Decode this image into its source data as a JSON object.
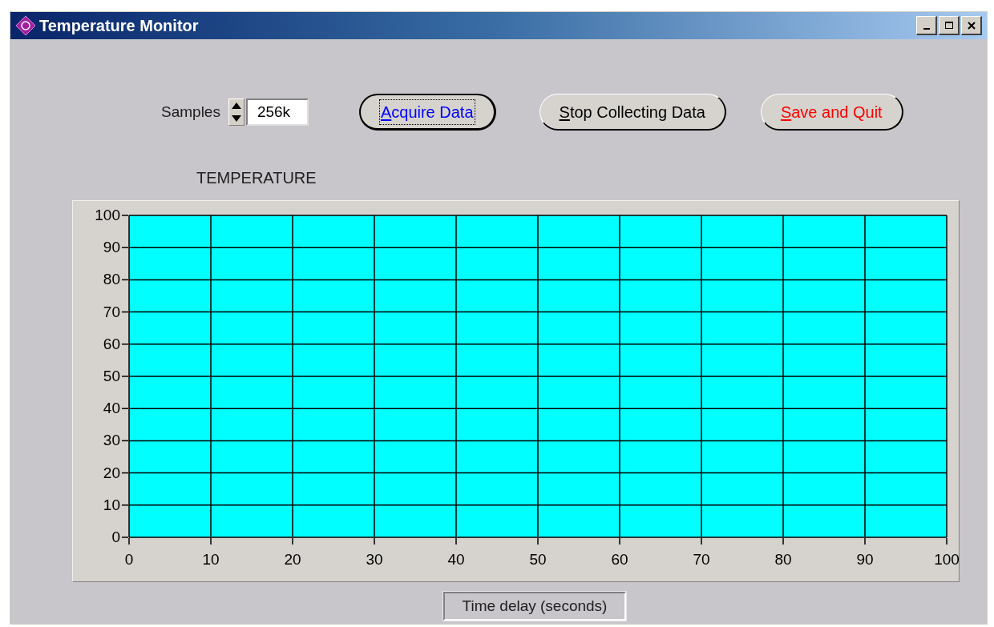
{
  "window": {
    "title": "Temperature Monitor",
    "controls": [
      {
        "kind": "minimize"
      },
      {
        "kind": "maximize"
      },
      {
        "kind": "close"
      }
    ]
  },
  "samples": {
    "label": "Samples",
    "value": "256k"
  },
  "buttons": [
    {
      "label": "Acquire Data",
      "color": "#0000ff",
      "focused": true
    },
    {
      "label": "Stop Collecting Data",
      "color": "#000000",
      "focused": false
    },
    {
      "label": "Save and Quit",
      "color": "#ff0000",
      "focused": false
    }
  ],
  "chart": {
    "chart_data": {
      "type": "line",
      "grid": true,
      "title": "TEMPERATURE",
      "xlabel": "Time delay (seconds)",
      "xlim": [
        0,
        100
      ],
      "ylim": [
        0,
        100
      ],
      "xticks": [
        0,
        10,
        20,
        30,
        40,
        50,
        60,
        70,
        80,
        90,
        100
      ],
      "yticks": [
        0,
        10,
        20,
        30,
        40,
        50,
        60,
        70,
        80,
        90,
        100
      ]
    }
  }
}
